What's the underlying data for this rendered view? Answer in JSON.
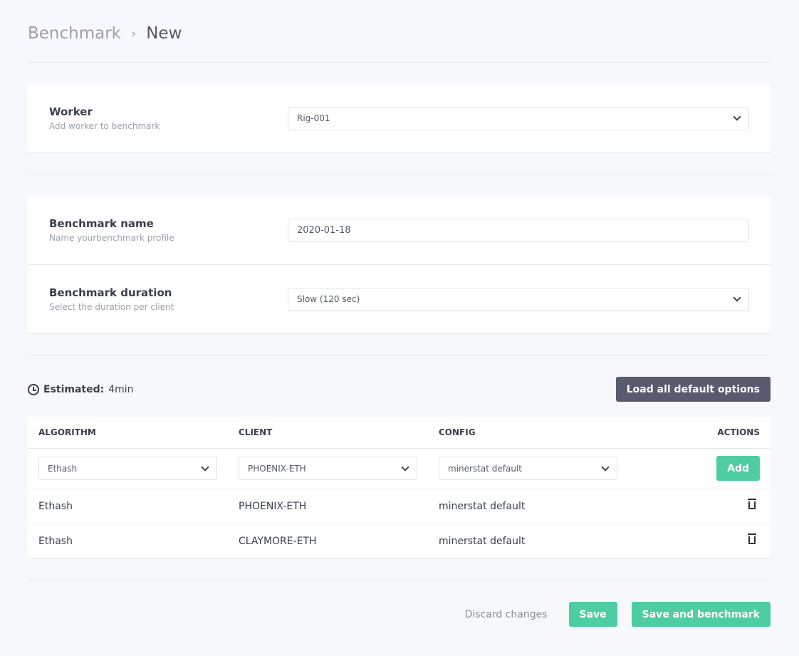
{
  "breadcrumb": {
    "parent": "Benchmark",
    "separator": "›",
    "current": "New"
  },
  "worker": {
    "title": "Worker",
    "subtitle": "Add worker to benchmark",
    "value": "Rig-001"
  },
  "name": {
    "title": "Benchmark name",
    "subtitle": "Name yourbenchmark profile",
    "value": "2020-01-18"
  },
  "duration": {
    "title": "Benchmark duration",
    "subtitle": "Select the duration per client",
    "value": "Slow (120 sec)"
  },
  "estimated": {
    "label": "Estimated:",
    "value": "4min",
    "icon": "clock-icon"
  },
  "load_defaults": "Load all default options",
  "table": {
    "headers": [
      "ALGORITHM",
      "CLIENT",
      "CONFIG",
      "ACTIONS"
    ],
    "new_row": {
      "algorithm": "Ethash",
      "client": "PHOENIX-ETH",
      "config": "minerstat default",
      "add": "Add"
    },
    "rows": [
      {
        "algorithm": "Ethash",
        "client": "PHOENIX-ETH",
        "config": "minerstat default"
      },
      {
        "algorithm": "Ethash",
        "client": "CLAYMORE-ETH",
        "config": "minerstat default"
      }
    ]
  },
  "footer": {
    "discard": "Discard changes",
    "save": "Save",
    "save_benchmark": "Save and benchmark"
  },
  "colors": {
    "accent": "#4ecda3",
    "dark_button": "#565b6e",
    "background": "#f7f8fc"
  }
}
